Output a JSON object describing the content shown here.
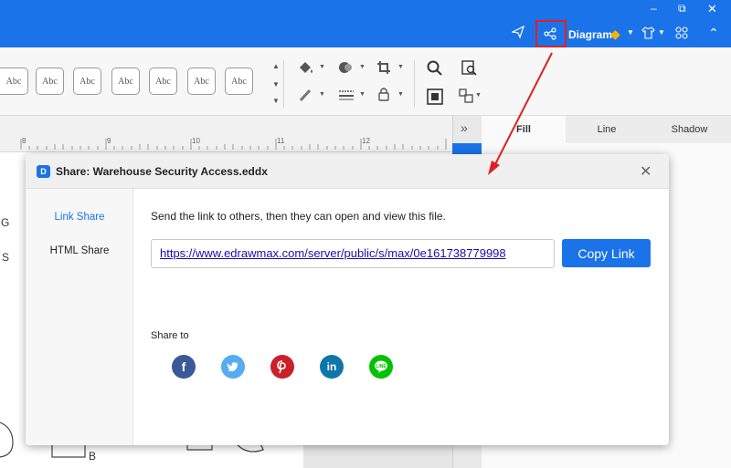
{
  "titlebar": {
    "diagram_label": "Diagram"
  },
  "ribbon": {
    "style_boxes": [
      "Abc",
      "Abc",
      "Abc",
      "Abc",
      "Abc",
      "Abc",
      "Abc"
    ]
  },
  "ruler": {
    "numbers": [
      "8",
      "9",
      "10",
      "11",
      "12"
    ]
  },
  "panel": {
    "tabs": [
      "Fill",
      "Line",
      "Shadow"
    ],
    "active_tab": "Fill"
  },
  "canvas": {
    "labels": [
      "G",
      "S",
      "B"
    ]
  },
  "dialog": {
    "title": "Share: Warehouse Security Access.eddx",
    "side_items": [
      "Link Share",
      "HTML Share"
    ],
    "description": "Send the link to others, then they can open and view this file.",
    "link_value": "https://www.edrawmax.com/server/public/s/max/0e161738779998",
    "copy_label": "Copy Link",
    "share_to_label": "Share to",
    "social": [
      {
        "name": "facebook",
        "color": "#3b5998",
        "glyph": "f"
      },
      {
        "name": "twitter",
        "color": "#55acee",
        "glyph": "t"
      },
      {
        "name": "pinterest",
        "color": "#cb2027",
        "glyph": "P"
      },
      {
        "name": "linkedin",
        "color": "#0e76a8",
        "glyph": "in"
      },
      {
        "name": "line",
        "color": "#00c300",
        "glyph": "L"
      }
    ]
  },
  "colors": {
    "accent": "#1a73e8",
    "highlight": "#e02020"
  }
}
